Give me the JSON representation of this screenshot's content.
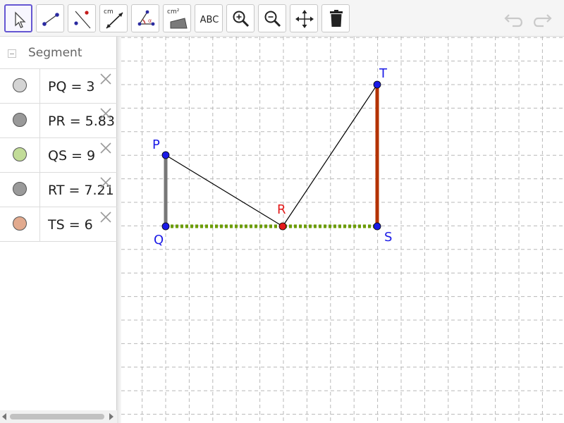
{
  "toolbar": {
    "tools": [
      {
        "name": "move-tool",
        "active": true
      },
      {
        "name": "segment-tool"
      },
      {
        "name": "perpendicular-line-tool"
      },
      {
        "name": "distance-tool",
        "text": "cm"
      },
      {
        "name": "angle-tool",
        "text": "α"
      },
      {
        "name": "area-tool",
        "text": "cm²"
      },
      {
        "name": "text-tool",
        "text": "ABC"
      },
      {
        "name": "zoom-in-tool"
      },
      {
        "name": "zoom-out-tool"
      },
      {
        "name": "move-graphics-view-tool"
      },
      {
        "name": "delete-tool"
      }
    ]
  },
  "algebra": {
    "group_label": "Segment",
    "rows": [
      {
        "text": "PQ = 3",
        "color": "#d4d4d4"
      },
      {
        "text": "PR = 5.83",
        "color": "#999999"
      },
      {
        "text": "QS = 9",
        "color": "#c2dc98"
      },
      {
        "text": "RT = 7.21",
        "color": "#9a9a9a"
      },
      {
        "text": "TS = 6",
        "color": "#e2aa8e"
      }
    ]
  },
  "graphics": {
    "points": [
      {
        "label": "P",
        "color": "#1a1ae6"
      },
      {
        "label": "Q",
        "color": "#1a1ae6"
      },
      {
        "label": "R",
        "color": "#e31b1b"
      },
      {
        "label": "S",
        "color": "#1a1ae6"
      },
      {
        "label": "T",
        "color": "#1a1ae6"
      }
    ],
    "segment_colors": {
      "PQ": "#777777",
      "QS": "#6b9c00",
      "TS": "#b43200",
      "PR": "#000000",
      "RT": "#000000"
    }
  }
}
